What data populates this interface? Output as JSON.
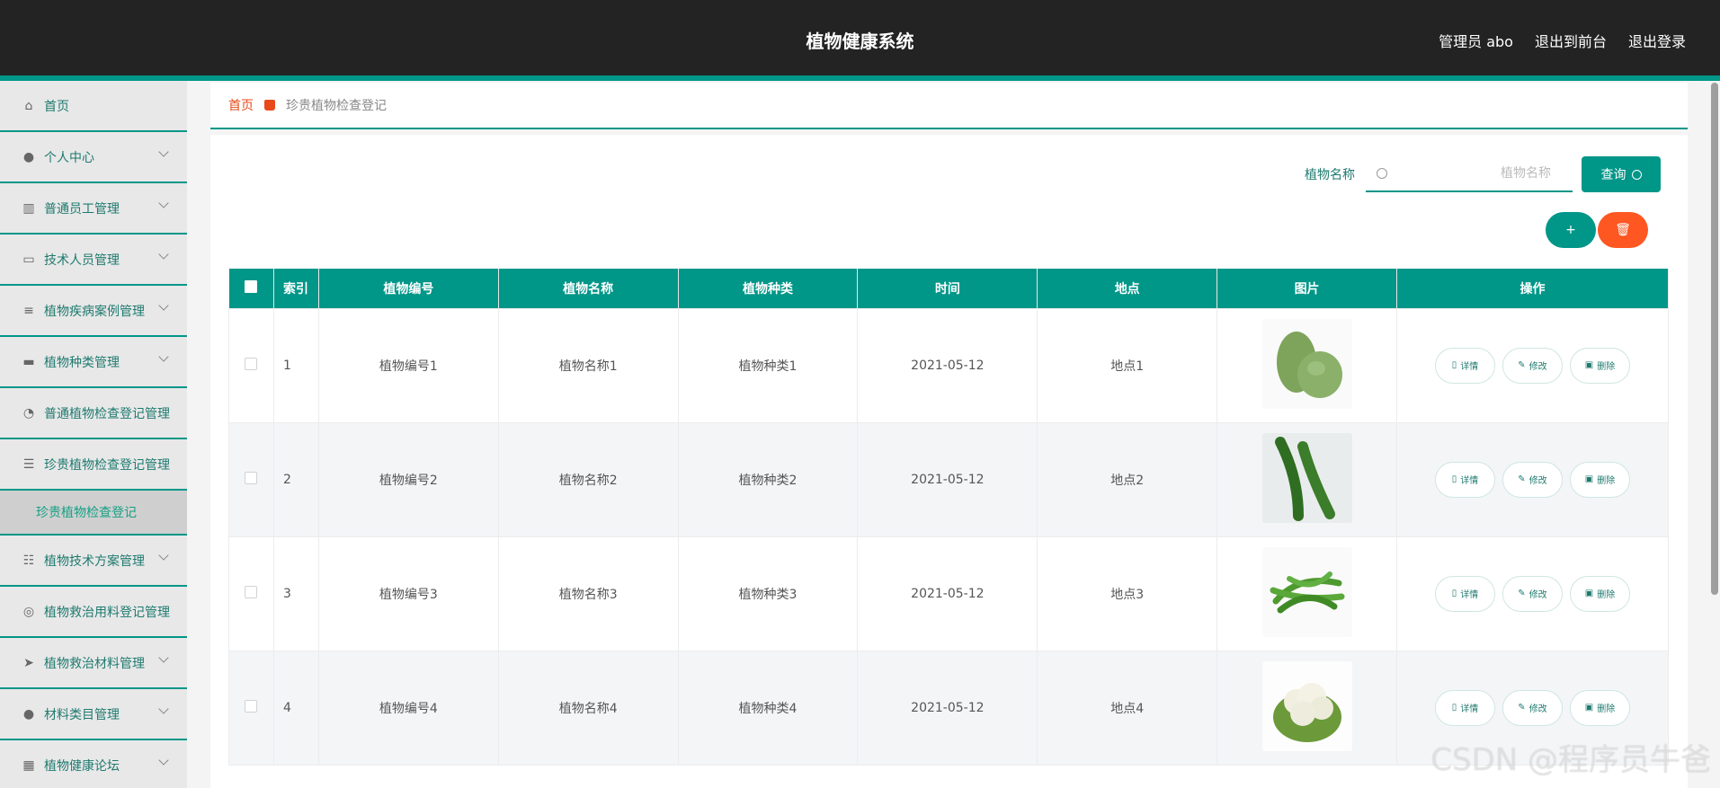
{
  "header": {
    "title": "植物健康系统",
    "admin": "管理员 abo",
    "front": "退出到前台",
    "logout": "退出登录"
  },
  "sidebar": {
    "items": [
      {
        "label": "首页",
        "icon": "home-icon",
        "chev": false
      },
      {
        "label": "个人中心",
        "icon": "user-icon",
        "chev": true
      },
      {
        "label": "普通员工管理",
        "icon": "library-icon",
        "chev": true
      },
      {
        "label": "技术人员管理",
        "icon": "chat-icon",
        "chev": true
      },
      {
        "label": "植物疾病案例管理",
        "icon": "sliders-icon",
        "chev": true
      },
      {
        "label": "植物种类管理",
        "icon": "monitor-icon",
        "chev": true
      },
      {
        "label": "普通植物检查登记管理",
        "icon": "dashboard-icon",
        "chev": false
      },
      {
        "label": "珍贵植物检查登记管理",
        "icon": "list-icon",
        "chev": false
      },
      {
        "label": "植物技术方案管理",
        "icon": "list-alt-icon",
        "chev": true
      },
      {
        "label": "植物救治用料登记管理",
        "icon": "compass-icon",
        "chev": false
      },
      {
        "label": "植物救治材料管理",
        "icon": "send-icon",
        "chev": true
      },
      {
        "label": "材料类目管理",
        "icon": "user-icon",
        "chev": true
      },
      {
        "label": "植物健康论坛",
        "icon": "grid-icon",
        "chev": true
      }
    ],
    "sub_item": "珍贵植物检查登记"
  },
  "breadcrumb": {
    "home": "首页",
    "current": "珍贵植物检查登记"
  },
  "search": {
    "label": "植物名称",
    "placeholder": "植物名称",
    "button": "查询"
  },
  "actions": {
    "add": "+",
    "delete": "🗑"
  },
  "table": {
    "headers": [
      "索引",
      "植物编号",
      "植物名称",
      "植物种类",
      "时间",
      "地点",
      "图片",
      "操作"
    ],
    "rows": [
      {
        "index": "1",
        "code": "植物编号1",
        "name": "植物名称1",
        "type": "植物种类1",
        "date": "2021-05-12",
        "place": "地点1",
        "image": "winter-melon"
      },
      {
        "index": "2",
        "code": "植物编号2",
        "name": "植物名称2",
        "type": "植物种类2",
        "date": "2021-05-12",
        "place": "地点2",
        "image": "cucumber"
      },
      {
        "index": "3",
        "code": "植物编号3",
        "name": "植物名称3",
        "type": "植物种类3",
        "date": "2021-05-12",
        "place": "地点3",
        "image": "green-beans"
      },
      {
        "index": "4",
        "code": "植物编号4",
        "name": "植物名称4",
        "type": "植物种类4",
        "date": "2021-05-12",
        "place": "地点4",
        "image": "cauliflower"
      }
    ],
    "ops": {
      "detail": "详情",
      "edit": "修改",
      "delete": "删除"
    }
  },
  "watermark": "CSDN @程序员牛爸",
  "colors": {
    "accent": "#009688",
    "danger": "#ff5722",
    "header": "#232323"
  }
}
